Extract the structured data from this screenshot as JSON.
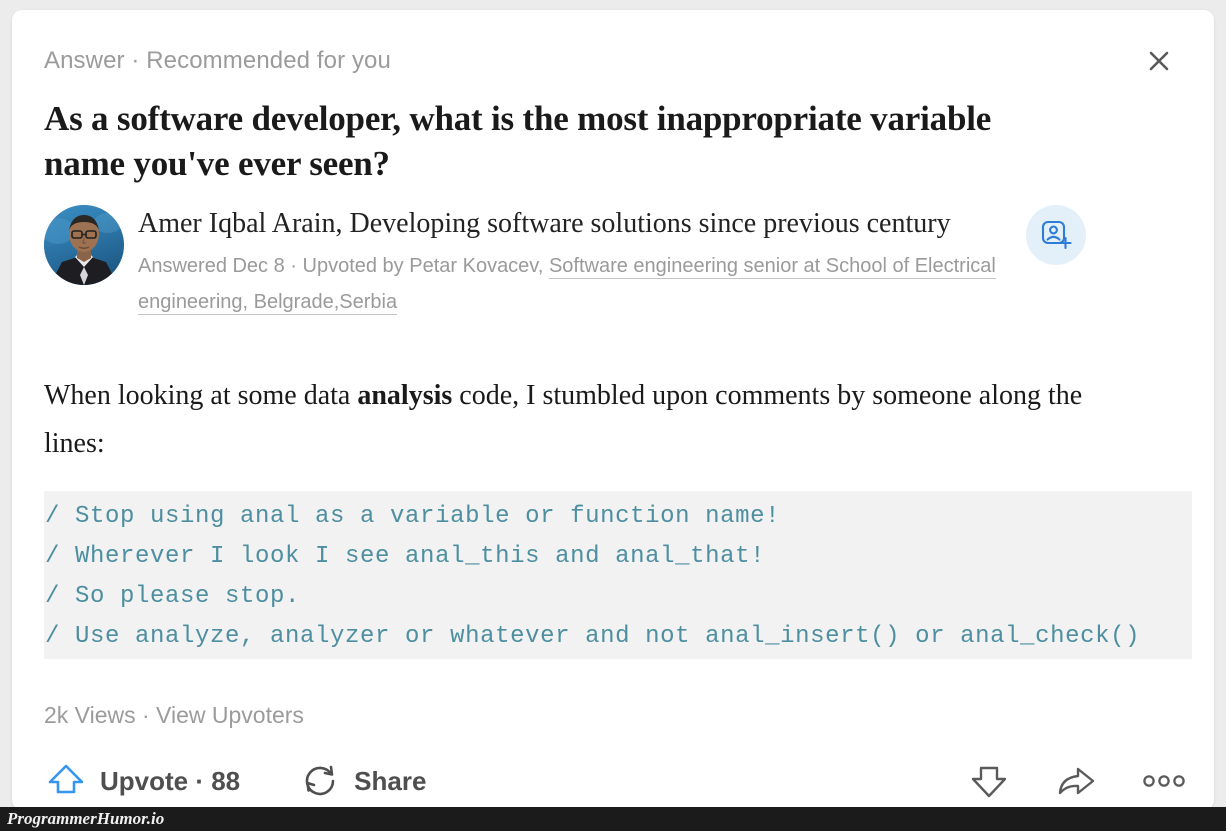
{
  "page": {
    "background_color": "#ececec",
    "card_background": "#ffffff"
  },
  "header": {
    "kicker": "Answer · Recommended for you",
    "close_icon": "close-icon"
  },
  "question": {
    "title": "As a software developer, what is the most inappropriate variable name you've ever seen?"
  },
  "author": {
    "avatar_icon": "user-photo-avatar",
    "name_line": "Amer Iqbal Arain, Developing software solutions since previous century",
    "meta_prefix": "Answered Dec 8 · Upvoted by Petar Kovacev, ",
    "meta_credential": "Software engineering senior at School of Electrical engineering, Belgrade,Serbia",
    "follow_icon": "add-user-icon",
    "follow_icon_color": "#2e7cd6",
    "follow_icon_bg": "#e3f0fa"
  },
  "body": {
    "text_before_bold": "When looking at some data ",
    "bold_word": "analysis",
    "text_after_bold": " code, I stumbled upon comments by someone along the lines:"
  },
  "code": {
    "text_color": "#4d8fa0",
    "background": "#f2f2f2",
    "lines": [
      "// Stop using anal as a variable or function name!",
      "// Wherever I look I see anal_this and anal_that!",
      "// So please stop.",
      "// Use analyze, analyzer or whatever and not anal_insert() or anal_check()"
    ]
  },
  "stats": {
    "views_line": "2k Views · View Upvoters"
  },
  "actions": {
    "upvote_icon": "upvote-arrow-icon",
    "upvote_icon_color": "#3397f0",
    "upvote_label": "Upvote · 88",
    "share_icon": "share-loop-icon",
    "share_label": "Share",
    "downvote_icon": "downvote-arrow-icon",
    "forward_icon": "forward-arrow-icon",
    "more_icon": "more-dots-icon"
  },
  "watermark": {
    "text": "ProgrammerHumor.io"
  }
}
